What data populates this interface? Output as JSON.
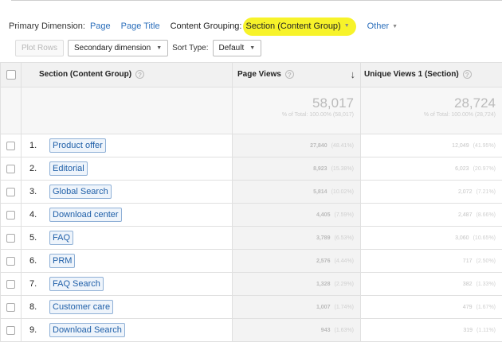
{
  "primary_dimension": {
    "label": "Primary Dimension:",
    "options": [
      "Page",
      "Page Title"
    ],
    "content_grouping_label": "Content Grouping:",
    "content_grouping_value": "Section (Content Group)",
    "other_label": "Other"
  },
  "toolbar": {
    "plot_rows": "Plot Rows",
    "secondary_dimension": "Secondary dimension",
    "sort_type_label": "Sort Type:",
    "sort_type_value": "Default"
  },
  "table": {
    "headers": {
      "section": "Section (Content Group)",
      "page_views": "Page Views",
      "unique_views": "Unique Views 1 (Section)"
    },
    "totals": {
      "page_views": "58,017",
      "page_views_sub": "% of Total: 100.00% (58,017)",
      "unique_views": "28,724",
      "unique_views_sub": "% of Total: 100.00% (28,724)"
    },
    "rows": [
      {
        "index": "1.",
        "section": "Product offer",
        "pv": "27,840",
        "pv_pct": "(48.41%)",
        "uv": "12,049",
        "uv_pct": "(41.95%)"
      },
      {
        "index": "2.",
        "section": "Editorial",
        "pv": "8,923",
        "pv_pct": "(15.38%)",
        "uv": "6,023",
        "uv_pct": "(20.97%)"
      },
      {
        "index": "3.",
        "section": "Global Search",
        "pv": "5,814",
        "pv_pct": "(10.02%)",
        "uv": "2,072",
        "uv_pct": "(7.21%)"
      },
      {
        "index": "4.",
        "section": "Download center",
        "pv": "4,405",
        "pv_pct": "(7.59%)",
        "uv": "2,487",
        "uv_pct": "(8.66%)"
      },
      {
        "index": "5.",
        "section": "FAQ",
        "pv": "3,789",
        "pv_pct": "(6.53%)",
        "uv": "3,060",
        "uv_pct": "(10.65%)"
      },
      {
        "index": "6.",
        "section": "PRM",
        "pv": "2,576",
        "pv_pct": "(4.44%)",
        "uv": "717",
        "uv_pct": "(2.50%)"
      },
      {
        "index": "7.",
        "section": "FAQ Search",
        "pv": "1,328",
        "pv_pct": "(2.29%)",
        "uv": "382",
        "uv_pct": "(1.33%)"
      },
      {
        "index": "8.",
        "section": "Customer care",
        "pv": "1,007",
        "pv_pct": "(1.74%)",
        "uv": "479",
        "uv_pct": "(1.67%)"
      },
      {
        "index": "9.",
        "section": "Download Search",
        "pv": "943",
        "pv_pct": "(1.63%)",
        "uv": "319",
        "uv_pct": "(1.11%)"
      }
    ]
  },
  "colors": {
    "highlight": "#f7f32a",
    "link": "#2a6ebb",
    "tag_border": "#8fb0d6"
  },
  "icons": {
    "help": "question-circle-icon",
    "sort": "arrow-down-icon",
    "dropdown": "caret-down-icon",
    "checkbox": "checkbox-icon"
  }
}
